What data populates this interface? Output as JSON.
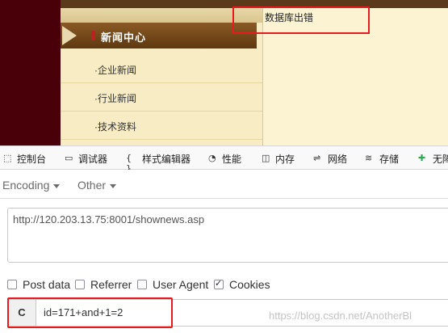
{
  "site": {
    "menu_title": "新闻中心",
    "menu_items": [
      "·企业新闻",
      "·行业新闻",
      "·技术资料"
    ],
    "error_message": "数据库出错"
  },
  "devtools": {
    "tabs": [
      {
        "icon": "inspector-icon",
        "glyph": "⬚",
        "label": "控制台"
      },
      {
        "icon": "console-icon",
        "glyph": "▭",
        "label": "调试器"
      },
      {
        "icon": "braces-icon",
        "glyph": "{ }",
        "label": "样式编辑器"
      },
      {
        "icon": "performance-icon",
        "glyph": "◔",
        "label": "性能"
      },
      {
        "icon": "memory-icon",
        "glyph": "◫",
        "label": "内存"
      },
      {
        "icon": "network-icon",
        "glyph": "⇌",
        "label": "网络"
      },
      {
        "icon": "storage-icon",
        "glyph": "≋",
        "label": "存储"
      },
      {
        "icon": "accessibility-icon",
        "glyph": "✚",
        "label": "无障"
      }
    ]
  },
  "hackbar": {
    "menu": {
      "encoding": "Encoding",
      "other": "Other"
    },
    "url": "http://120.203.13.75:8001/shownews.asp",
    "options": [
      {
        "label": "Post data",
        "checked": false
      },
      {
        "label": "Referrer",
        "checked": false
      },
      {
        "label": "User Agent",
        "checked": false
      },
      {
        "label": "Cookies",
        "checked": true
      }
    ],
    "cookie_button": "C",
    "cookie_value": "id=171+and+1=2"
  },
  "watermark": "https://blog.csdn.net/AnotherBl"
}
